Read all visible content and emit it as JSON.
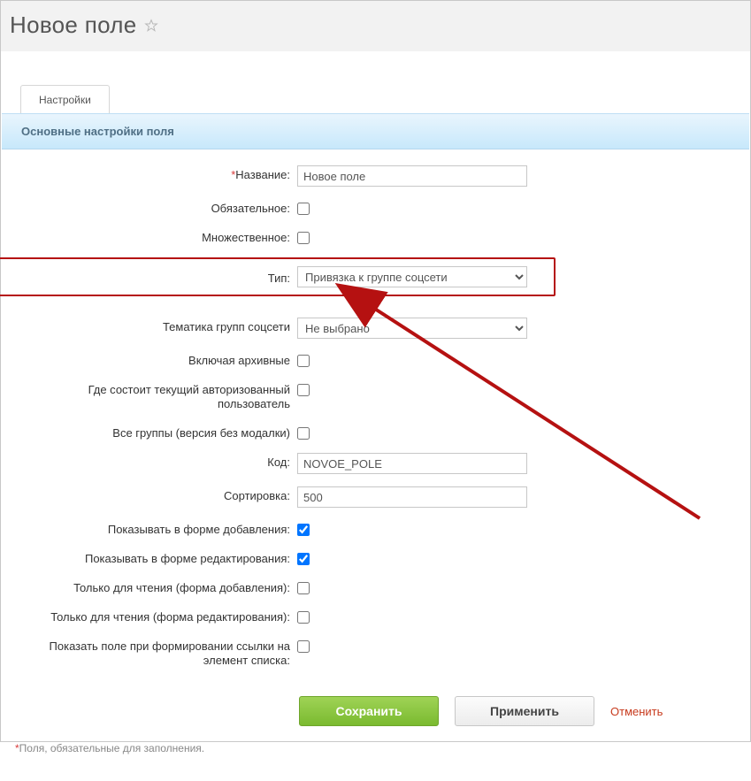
{
  "header": {
    "title": "Новое поле"
  },
  "tabs": {
    "settings": "Настройки"
  },
  "section": {
    "title": "Основные настройки поля"
  },
  "form": {
    "name_label": "Название:",
    "name_value": "Новое поле",
    "required_label": "Обязательное:",
    "required_checked": false,
    "multiple_label": "Множественное:",
    "multiple_checked": false,
    "type_label": "Тип:",
    "type_value": "Привязка к группе соцсети",
    "topic_label": "Тематика групп соцсети",
    "topic_value": "Не выбрано",
    "archived_label": "Включая архивные",
    "archived_checked": false,
    "member_label": "Где состоит текущий авторизованный пользователь",
    "member_checked": false,
    "allgroups_label": "Все группы (версия без модалки)",
    "allgroups_checked": false,
    "code_label": "Код:",
    "code_value": "NOVOE_POLE",
    "sort_label": "Сортировка:",
    "sort_value": "500",
    "show_add_label": "Показывать в форме добавления:",
    "show_add_checked": true,
    "show_edit_label": "Показывать в форме редактирования:",
    "show_edit_checked": true,
    "ro_add_label": "Только для чтения (форма добавления):",
    "ro_add_checked": false,
    "ro_edit_label": "Только для чтения (форма редактирования):",
    "ro_edit_checked": false,
    "link_form_label": "Показать поле при формировании ссылки на элемент списка:",
    "link_form_checked": false
  },
  "buttons": {
    "save": "Сохранить",
    "apply": "Применить",
    "cancel": "Отменить"
  },
  "footer": {
    "note": "Поля, обязательные для заполнения."
  }
}
